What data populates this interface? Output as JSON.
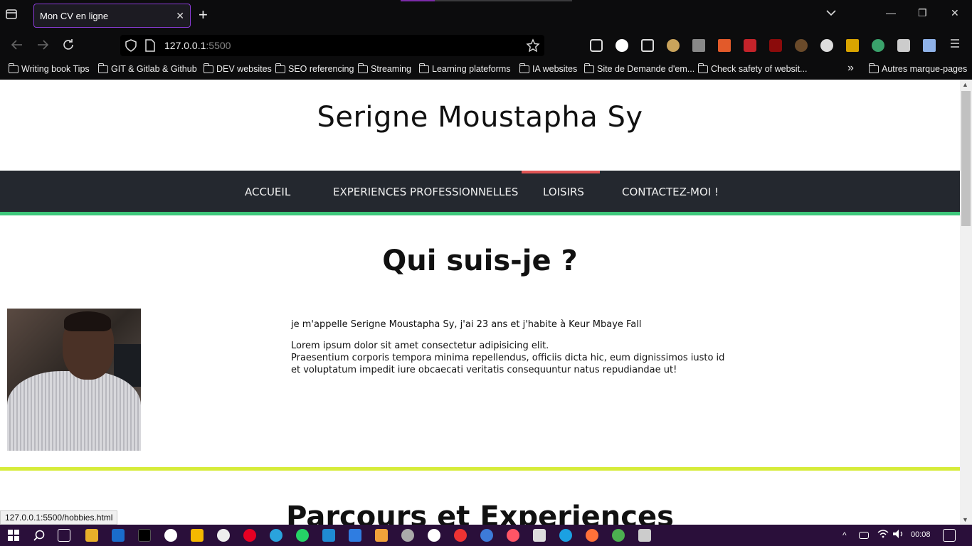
{
  "browser": {
    "tab_title": "Mon CV en ligne",
    "tab_close": "✕",
    "new_tab": "+",
    "url_host": "127.0.0.1",
    "url_port": ":5500",
    "status_link": "127.0.0.1:5500/hobbies.html",
    "window_minimize": "—",
    "window_restore": "❐",
    "window_close": "✕",
    "bookmarks": [
      {
        "label": "Writing book Tips"
      },
      {
        "label": "GIT & Gitlab & Github"
      },
      {
        "label": "DEV websites"
      },
      {
        "label": "SEO referencing"
      },
      {
        "label": "Streaming"
      },
      {
        "label": "Learning plateforms"
      },
      {
        "label": "IA websites"
      },
      {
        "label": "Site de Demande d'em..."
      },
      {
        "label": "Check safety of websit..."
      }
    ],
    "bookmarks_overflow": "»",
    "other_bookmarks": "Autres marque-pages"
  },
  "page": {
    "site_title": "Serigne Moustapha Sy",
    "nav": {
      "items": [
        {
          "label": "ACCUEIL"
        },
        {
          "label": "EXPERIENCES PROFESSIONNELLES"
        },
        {
          "label": "LOISIRS"
        },
        {
          "label": "CONTACTEZ-MOI !"
        }
      ],
      "active_index": 2
    },
    "about": {
      "heading": "Qui suis-je ?",
      "intro": "je m'appelle Serigne Moustapha Sy, j'ai 23 ans et j'habite à Keur Mbaye Fall",
      "lorem_line1": "Lorem ipsum dolor sit amet consectetur adipisicing elit.",
      "lorem_line2": "Praesentium corporis tempora minima repellendus, officiis dicta hic, eum dignissimos iusto id et voluptatum impedit iure obcaecati veritatis consequuntur natus repudiandae ut!"
    },
    "next_section_heading": "Parcours et Experiences"
  },
  "taskbar": {
    "clock": "00:08"
  },
  "colors": {
    "nav_bg": "#24282f",
    "active_accent": "#e05555",
    "green_divider": "#3dc77b",
    "lime_divider": "#d6ec3a",
    "tab_border": "#8a3cd6",
    "taskbar_bg": "#2a0f3a"
  }
}
